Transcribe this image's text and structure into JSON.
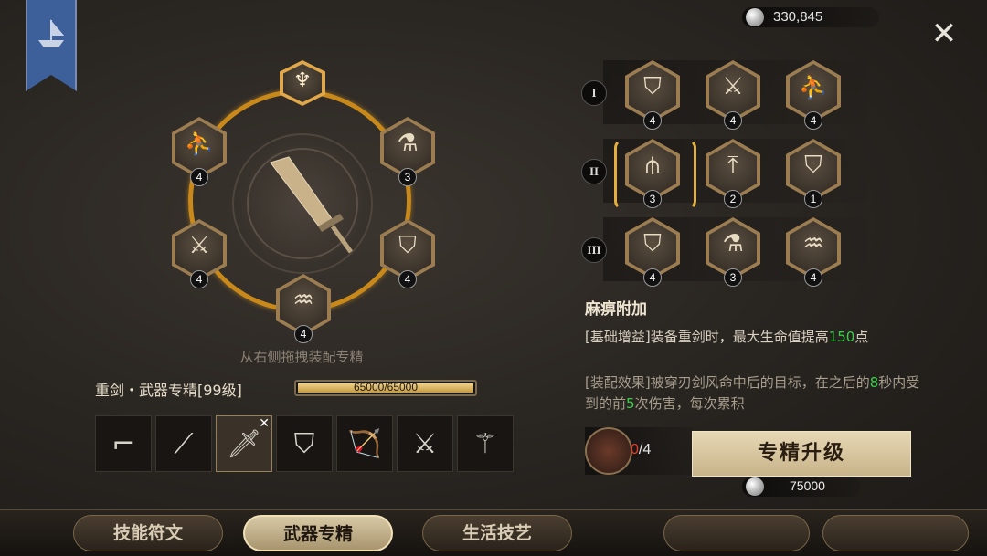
{
  "currency": {
    "amount": "330,845"
  },
  "close_label": "✕",
  "ring": {
    "nodes": [
      {
        "id": "left-top",
        "count": "4",
        "icon": "athlete-icon"
      },
      {
        "id": "right-top",
        "count": "3",
        "icon": "potion-icon"
      },
      {
        "id": "left-bottom",
        "count": "4",
        "icon": "crossed-swords-icon"
      },
      {
        "id": "right-bottom",
        "count": "4",
        "icon": "shield-icon"
      },
      {
        "id": "bottom",
        "count": "4",
        "icon": "waves-figure-icon"
      }
    ],
    "hint": "从右侧拖拽装配专精"
  },
  "skill": {
    "label": "重剑・武器专精[99级]",
    "xp_text": "65000/65000",
    "xp_fraction": 1.0
  },
  "weapons": [
    {
      "icon": "rifle-icon"
    },
    {
      "icon": "saber-icon"
    },
    {
      "icon": "greatsword-icon",
      "selected": true,
      "mark": "✕"
    },
    {
      "icon": "shield-sword-icon"
    },
    {
      "icon": "bow-icon"
    },
    {
      "icon": "dual-blades-icon"
    },
    {
      "icon": "staff-icon"
    }
  ],
  "tiers": [
    {
      "label": "I",
      "cells": [
        {
          "count": "4",
          "icon": "shield-icon"
        },
        {
          "count": "4",
          "icon": "crossed-swords-icon"
        },
        {
          "count": "4",
          "icon": "athlete-icon"
        }
      ]
    },
    {
      "label": "II",
      "cells": [
        {
          "count": "3",
          "icon": "triple-sword-icon",
          "selected": true
        },
        {
          "count": "2",
          "icon": "sword-up-icon"
        },
        {
          "count": "1",
          "icon": "shield-icon"
        }
      ]
    },
    {
      "label": "III",
      "cells": [
        {
          "count": "4",
          "icon": "shield-slash-icon"
        },
        {
          "count": "3",
          "icon": "potion-icon"
        },
        {
          "count": "4",
          "icon": "waves-figure-icon"
        }
      ]
    }
  ],
  "effect": {
    "title": "麻痹附加",
    "line1_a": "[基础增益]装备重剑时，最大生命值提高",
    "line1_num": "150",
    "line1_b": "点",
    "line2_a": "[装配效果]被穿刃剑风命中后的目标，在之后的",
    "line2_n1": "8",
    "line2_b": "秒内受到的前",
    "line2_n2": "5",
    "line2_c": "次伤害，每次累积"
  },
  "materials": {
    "have": "0",
    "need": "/4"
  },
  "upgrade_label": "专精升级",
  "cost": "75000",
  "tabs": [
    {
      "label": "技能符文",
      "active": false
    },
    {
      "label": "武器专精",
      "active": true
    },
    {
      "label": "生活技艺",
      "active": false
    }
  ],
  "colors": {
    "ring": "#c8891a",
    "accent_green": "#3ad04a",
    "banner": "#3d5f9a",
    "selected": "#e3b040"
  }
}
